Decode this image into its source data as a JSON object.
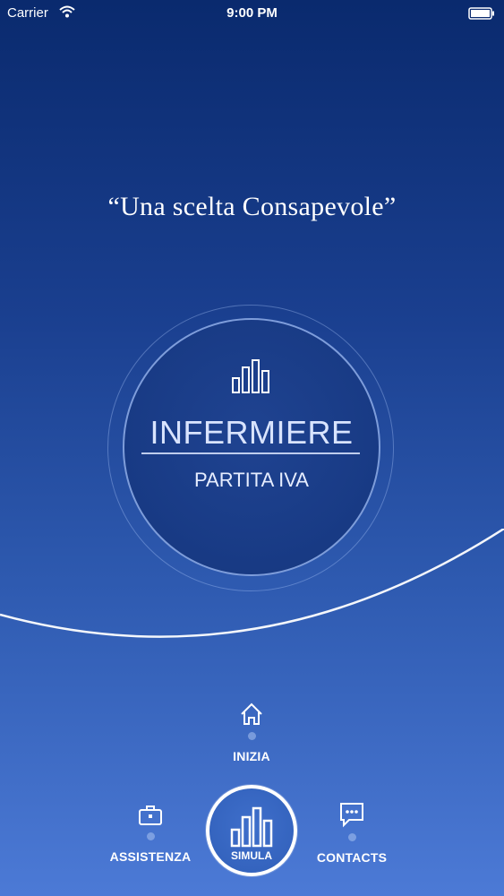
{
  "status_bar": {
    "carrier": "Carrier",
    "time": "9:00 PM",
    "icons": [
      "wifi-icon",
      "battery-icon"
    ]
  },
  "tagline": "“Una scelta Consapevole”",
  "circle": {
    "icon": "bar-chart-icon",
    "title": "INFERMIERE",
    "subtitle": "PARTITA IVA"
  },
  "nav": {
    "inizia": {
      "label": "INIZIA",
      "icon": "home-icon"
    },
    "assistenza": {
      "label": "ASSISTENZA",
      "icon": "briefcase-icon"
    },
    "simula": {
      "label": "SIMULA",
      "icon": "bar-chart-icon"
    },
    "contacts": {
      "label": "CONTACTS",
      "icon": "chat-bubble-icon"
    }
  },
  "colors": {
    "background_top": "#0a2a6e",
    "background_bottom": "#4c7ad6",
    "text": "#ffffff"
  }
}
